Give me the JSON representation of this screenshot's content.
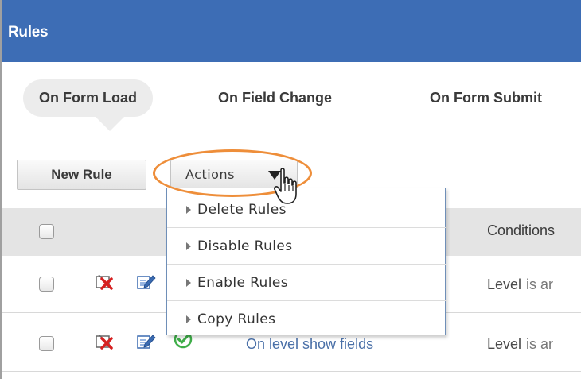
{
  "header": {
    "title": "Rules"
  },
  "tabs": [
    {
      "label": "On Form Load",
      "active": true
    },
    {
      "label": "On Field Change",
      "active": false
    },
    {
      "label": "On Form Submit",
      "active": false
    }
  ],
  "toolbar": {
    "new_rule_label": "New Rule",
    "actions_label": "Actions"
  },
  "actions_menu": [
    {
      "label": "Delete Rules"
    },
    {
      "label": "Disable Rules"
    },
    {
      "label": "Enable Rules"
    },
    {
      "label": "Copy Rules"
    }
  ],
  "table": {
    "columns": {
      "conditions": "Conditions"
    },
    "rows": [
      {
        "name": "",
        "condition_field": "Level",
        "condition_op": "is ar",
        "icons": [
          "delete-icon",
          "edit-icon"
        ]
      },
      {
        "name": "On level show fields",
        "condition_field": "Level",
        "condition_op": "is ar",
        "icons": [
          "delete-icon",
          "edit-icon",
          "check-icon"
        ]
      }
    ]
  },
  "colors": {
    "header_bg": "#3d6db5",
    "highlight": "#ee8e3a",
    "link": "#4a70a8",
    "enabled_check": "#3fae49"
  }
}
